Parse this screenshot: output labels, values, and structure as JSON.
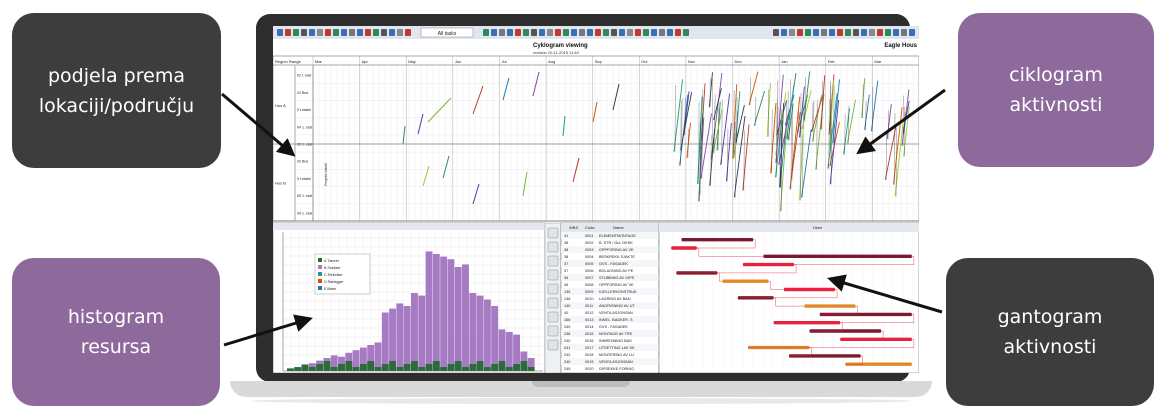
{
  "callouts": {
    "location_split": "podjela prema\nlokaciji/području",
    "activity_cyclogram": "ciklogram\naktivnosti",
    "resource_histogram": "histogram\nresursa",
    "activity_gantt": "gantogram\naktivnosti"
  },
  "colors": {
    "dark_box": "#3d3d3d",
    "purple_box": "#8e6a9c",
    "histogram_bar": "#a77bc3",
    "histogram_base": "#2e6b3a",
    "gantt_bar_dark": "#7a1a2e",
    "gantt_bar_red": "#e6233f",
    "gantt_bar_orange": "#e08a2a"
  },
  "app": {
    "toolbar_dropdown": "All tasks",
    "chart_title": "Cyklogram viewing",
    "chart_subtitle": "revision 10-11-2015 11:40",
    "project_name": "Eagle Hous"
  },
  "cyclogram": {
    "header_col1": "Region",
    "header_col2": "Range",
    "vertical_label": "Projekt tabell",
    "month_labels": [
      "Mar",
      "Apr",
      "May",
      "Jun",
      "Jul",
      "Aug",
      "Sep",
      "Oct",
      "Nov",
      "Dec",
      "Jan",
      "Feb",
      "Mar"
    ],
    "zone_labels": [
      "Hus A",
      "Hus B"
    ],
    "floor_labels": [
      "02 t. etat",
      "01 Bne",
      "0 t.etabe",
      "04 1. etat",
      "03 1. etat",
      "02 Bne",
      "0 t.etabe",
      "05 1. etat",
      "04 1. etat"
    ]
  },
  "histogram": {
    "legend_items": [
      "A Tømrer",
      "B Snekker",
      "C Elektriker",
      "D Rørlegger",
      "E Maler"
    ],
    "resource_loads": [
      0.02,
      0.03,
      0.05,
      0.06,
      0.08,
      0.1,
      0.12,
      0.11,
      0.14,
      0.16,
      0.18,
      0.2,
      0.22,
      0.45,
      0.48,
      0.52,
      0.5,
      0.6,
      0.58,
      0.92,
      0.9,
      0.88,
      0.86,
      0.8,
      0.82,
      0.6,
      0.58,
      0.55,
      0.5,
      0.32,
      0.3,
      0.28,
      0.15,
      0.1
    ]
  },
  "task_table": {
    "headers": [
      "WBS",
      "Code",
      "Name"
    ],
    "rows": [
      [
        "41",
        "0001",
        "ELEMENTMONTAGE"
      ],
      [
        "38",
        "0002",
        "B. STR / Gul. DEKK"
      ],
      [
        "38",
        "0003",
        "OPPFORING AV VE"
      ],
      [
        "38",
        "0004",
        "BESKREKK SJAKTE"
      ],
      [
        "37",
        "0005",
        "GVS - FASADEK"
      ],
      [
        "37",
        "0006",
        "BOLAGNING AV PE"
      ],
      [
        "36",
        "0007",
        "STUBBING AV GIPS"
      ],
      [
        "36",
        "0008",
        "OPPFORING AV VE"
      ],
      [
        "135",
        "0009",
        "KJELLERKONSTRUK"
      ],
      [
        "138",
        "0010",
        "LAGRING AV BAD"
      ],
      [
        "140",
        "0011",
        "ANGRISNING AV UT"
      ],
      [
        "40",
        "0012",
        "VENTILASJONSAN"
      ],
      [
        "166",
        "0013",
        "INNEL. BADKER. S"
      ],
      [
        "240",
        "0014",
        "GVS - FASADEK"
      ],
      [
        "238",
        "0015",
        "MONTAGE AV TRE"
      ],
      [
        "240",
        "0016",
        "INNREDNING BAD"
      ],
      [
        "241",
        "0017",
        "UTSETTING LAV SK"
      ],
      [
        "242",
        "0018",
        "MONTERING AV LU"
      ],
      [
        "240",
        "0019",
        "VENTILASJONSAN"
      ],
      [
        "245",
        "0020",
        "GIPSEKKE FORING"
      ]
    ]
  },
  "gantt": {
    "header_label": "Ukee",
    "bars": [
      {
        "start": 0.08,
        "end": 0.36,
        "color": "dark"
      },
      {
        "start": 0.04,
        "end": 0.14,
        "color": "red"
      },
      {
        "start": 0.4,
        "end": 0.98,
        "color": "dark"
      },
      {
        "start": 0.32,
        "end": 0.52,
        "color": "red"
      },
      {
        "start": 0.06,
        "end": 0.22,
        "color": "dark"
      },
      {
        "start": 0.24,
        "end": 0.42,
        "color": "orange"
      },
      {
        "start": 0.48,
        "end": 0.68,
        "color": "red"
      },
      {
        "start": 0.3,
        "end": 0.44,
        "color": "dark"
      },
      {
        "start": 0.56,
        "end": 0.76,
        "color": "orange"
      },
      {
        "start": 0.62,
        "end": 0.98,
        "color": "dark"
      },
      {
        "start": 0.44,
        "end": 0.7,
        "color": "red"
      },
      {
        "start": 0.58,
        "end": 0.86,
        "color": "dark"
      },
      {
        "start": 0.7,
        "end": 0.98,
        "color": "red"
      },
      {
        "start": 0.34,
        "end": 0.58,
        "color": "orange"
      },
      {
        "start": 0.5,
        "end": 0.78,
        "color": "dark"
      },
      {
        "start": 0.72,
        "end": 0.98,
        "color": "orange"
      }
    ]
  }
}
